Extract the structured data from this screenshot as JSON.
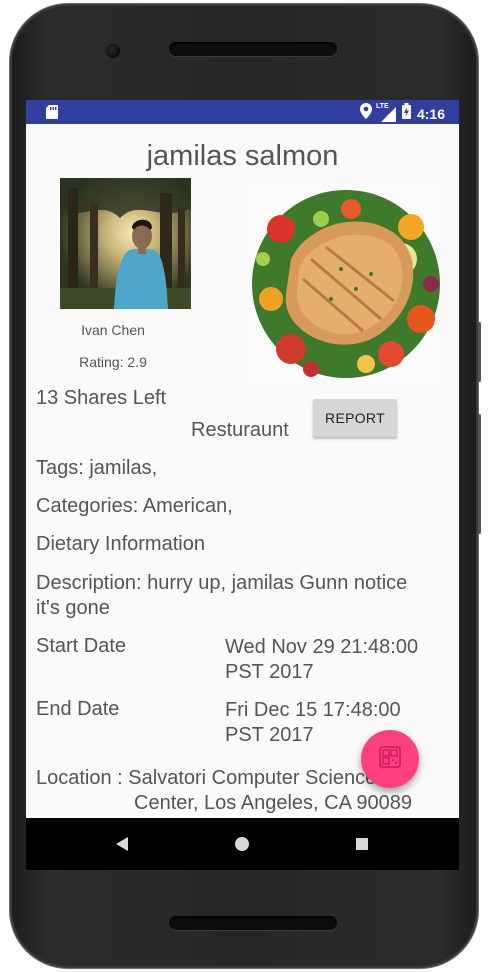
{
  "status_bar": {
    "time": "4:16",
    "network": "LTE",
    "icons": [
      "sd-card-icon",
      "location-icon",
      "signal-icon",
      "battery-charging-icon"
    ]
  },
  "listing": {
    "title": "jamilas salmon",
    "user_name": "Ivan Chen",
    "rating_text": "Rating: 2.9",
    "shares_text": "13 Shares Left",
    "type_text": "Resturaunt",
    "report_label": "REPORT",
    "tags_text": "Tags: jamilas,",
    "categories_text": "Categories: American,",
    "dietary_text": "Dietary Information",
    "description_text": "Description: hurry up, jamilas Gunn notice it's gone",
    "start_label": "Start Date",
    "start_value": "Wed Nov 29 21:48:00 PST 2017",
    "end_label": "End Date",
    "end_value": "Fri Dec 15 17:48:00 PST 2017",
    "location_label": "Location :",
    "location_line1": "Salvatori Computer Science",
    "location_line2": "Center, Los Angeles, CA 90089"
  },
  "fab": {
    "icon": "qr-scan-icon"
  },
  "nav_bar": {
    "icons": [
      "back-icon",
      "home-icon",
      "recents-icon"
    ]
  },
  "colors": {
    "status_bar": "#303f9f",
    "fab": "#ff4081",
    "text": "#555555",
    "report_button": "#d6d6d6"
  }
}
